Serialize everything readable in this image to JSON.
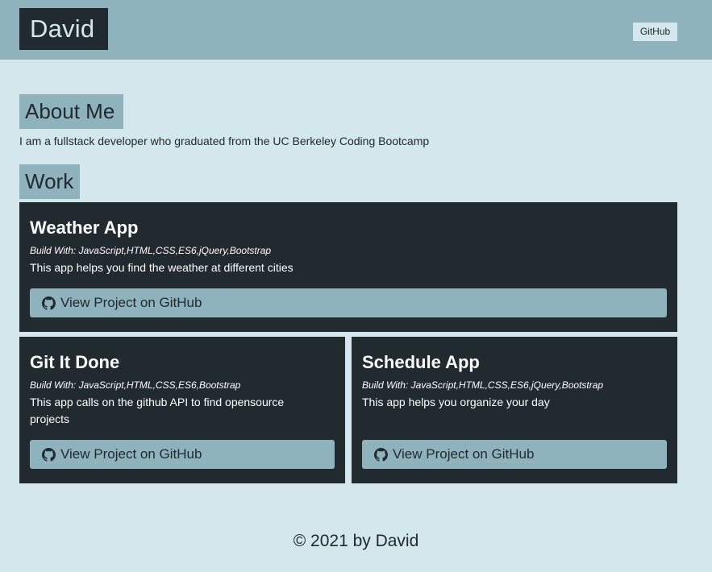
{
  "header": {
    "brand": "David",
    "github_link": "GitHub"
  },
  "about": {
    "title": "About Me",
    "text": "I am a fullstack developer who graduated from the UC Berkeley Coding Bootcamp"
  },
  "work": {
    "title": "Work",
    "projects": [
      {
        "title": "Weather App",
        "built_with": "Build With: JavaScript,HTML,CSS,ES6,jQuery,Bootstrap",
        "description": "This app helps you find the weather at different cities",
        "button_label": "View Project on GitHub",
        "button_icon": "github-icon"
      },
      {
        "title": "Git It Done",
        "built_with": "Build With: JavaScript,HTML,CSS,ES6,Bootstrap",
        "description": "This app calls on the github API to find opensource projects",
        "button_label": "View Project on GitHub",
        "button_icon": "github-icon"
      },
      {
        "title": "Schedule App",
        "built_with": "Build With: JavaScript,HTML,CSS,ES6,jQuery,Bootstrap",
        "description": "This app helps you organize your day",
        "button_label": "View Project on GitHub",
        "button_icon": "github-icon"
      }
    ]
  },
  "footer": {
    "text": "© 2021 by David"
  },
  "colors": {
    "background": "#d3e7ec",
    "accent": "#8eb3bc",
    "dark": "#212a2e"
  }
}
